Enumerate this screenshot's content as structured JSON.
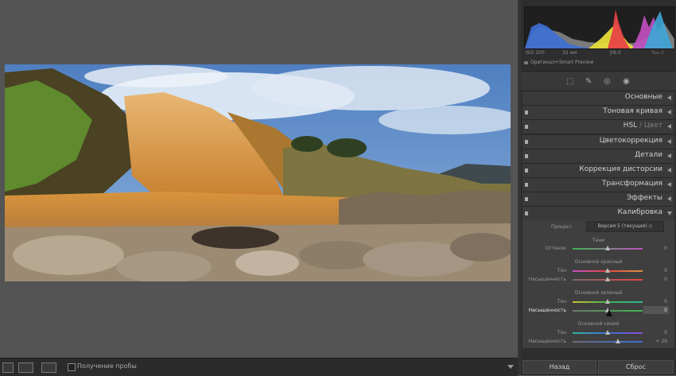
{
  "histogram": {
    "iso": "ISO 200",
    "focal": "32 мм",
    "aperture": "ƒ/8.0",
    "shutter": "¹⁄₂₀₀ с",
    "original_label": "Оригинал+Smart Preview"
  },
  "panels": [
    {
      "label": "Основные",
      "extra": ""
    },
    {
      "label": "Тоновая кривая",
      "extra": ""
    },
    {
      "label": "HSL",
      "extra": " / Цвет"
    },
    {
      "label": "Цветокоррекция",
      "extra": ""
    },
    {
      "label": "Детали",
      "extra": ""
    },
    {
      "label": "Коррекция дисторсии",
      "extra": ""
    },
    {
      "label": "Трансформация",
      "extra": ""
    },
    {
      "label": "Эффекты",
      "extra": ""
    },
    {
      "label": "Калибровка",
      "extra": ""
    }
  ],
  "calibration": {
    "process_label": "Процесс",
    "process_value": "Версия 5 (текущая)",
    "shadows": {
      "title": "Тени",
      "tint_label": "Оттенок",
      "tint_value": "0",
      "tint_level": 0
    },
    "red": {
      "title": "Основной красный",
      "hue_label": "Тон",
      "hue_value": "0",
      "hue_level": 0,
      "sat_label": "Насыщенность",
      "sat_value": "0",
      "sat_level": 0
    },
    "green": {
      "title": "Основной зеленый",
      "hue_label": "Тон",
      "hue_value": "0",
      "hue_level": 0,
      "sat_label": "Насыщенность",
      "sat_value": "0",
      "sat_level": 0
    },
    "blue": {
      "title": "Основной синий",
      "hue_label": "Тон",
      "hue_value": "0",
      "hue_level": 0,
      "sat_label": "Насыщенность",
      "sat_value": "+ 29",
      "sat_level": 29
    }
  },
  "bottom": {
    "back_label": "Назад",
    "reset_label": "Сброс"
  },
  "toolbar": {
    "soft_proof_label": "Получение пробы"
  },
  "colors": {
    "accent_red": "#e84545",
    "accent_green": "#3fb34f",
    "accent_blue": "#3d6fd6",
    "accent_magenta": "#c24fc2"
  }
}
